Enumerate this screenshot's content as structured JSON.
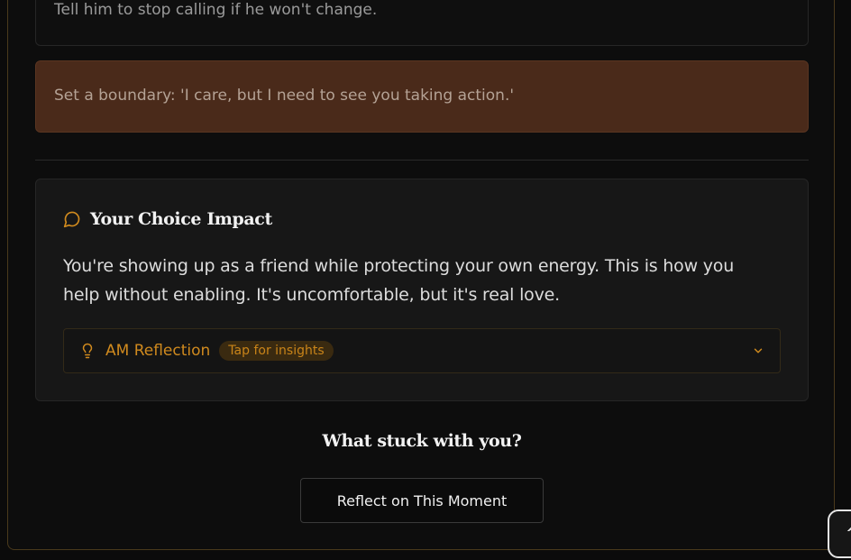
{
  "options": [
    {
      "text": "Tell him to stop calling if he won't change."
    },
    {
      "text": "Set a boundary: 'I care, but I need to see you taking action.'"
    }
  ],
  "impact": {
    "icon": "chat-bubble-icon",
    "title": "Your Choice Impact",
    "body": "You're showing up as a friend while protecting your own energy. This is how you help without enabling. It's uncomfortable, but it's real love."
  },
  "reflection": {
    "icon": "lightbulb-icon",
    "label": "AM Reflection",
    "badge": "Tap for insights",
    "expand_icon": "chevron-down-icon"
  },
  "prompt": {
    "title": "What stuck with you?",
    "button_label": "Reflect on This Moment"
  },
  "scroll_top": {
    "icon": "chevron-up-icon",
    "label": "^"
  },
  "colors": {
    "accent": "#d08a1e",
    "selected_option_bg": "#4a2a1a",
    "card_bg": "#171717",
    "page_bg": "#0b0b0b"
  }
}
